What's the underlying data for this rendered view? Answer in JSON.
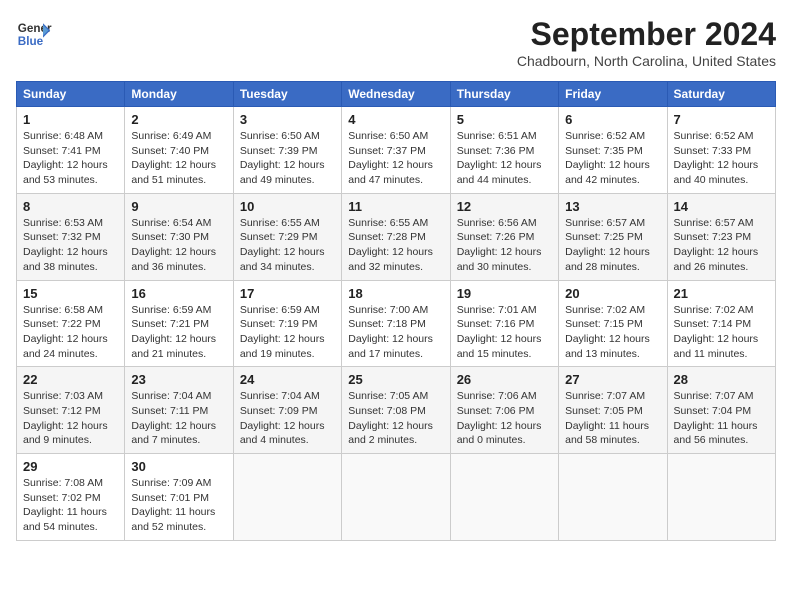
{
  "header": {
    "logo_line1": "General",
    "logo_line2": "Blue",
    "month": "September 2024",
    "location": "Chadbourn, North Carolina, United States"
  },
  "weekdays": [
    "Sunday",
    "Monday",
    "Tuesday",
    "Wednesday",
    "Thursday",
    "Friday",
    "Saturday"
  ],
  "weeks": [
    [
      {
        "day": "1",
        "info": "Sunrise: 6:48 AM\nSunset: 7:41 PM\nDaylight: 12 hours\nand 53 minutes."
      },
      {
        "day": "2",
        "info": "Sunrise: 6:49 AM\nSunset: 7:40 PM\nDaylight: 12 hours\nand 51 minutes."
      },
      {
        "day": "3",
        "info": "Sunrise: 6:50 AM\nSunset: 7:39 PM\nDaylight: 12 hours\nand 49 minutes."
      },
      {
        "day": "4",
        "info": "Sunrise: 6:50 AM\nSunset: 7:37 PM\nDaylight: 12 hours\nand 47 minutes."
      },
      {
        "day": "5",
        "info": "Sunrise: 6:51 AM\nSunset: 7:36 PM\nDaylight: 12 hours\nand 44 minutes."
      },
      {
        "day": "6",
        "info": "Sunrise: 6:52 AM\nSunset: 7:35 PM\nDaylight: 12 hours\nand 42 minutes."
      },
      {
        "day": "7",
        "info": "Sunrise: 6:52 AM\nSunset: 7:33 PM\nDaylight: 12 hours\nand 40 minutes."
      }
    ],
    [
      {
        "day": "8",
        "info": "Sunrise: 6:53 AM\nSunset: 7:32 PM\nDaylight: 12 hours\nand 38 minutes."
      },
      {
        "day": "9",
        "info": "Sunrise: 6:54 AM\nSunset: 7:30 PM\nDaylight: 12 hours\nand 36 minutes."
      },
      {
        "day": "10",
        "info": "Sunrise: 6:55 AM\nSunset: 7:29 PM\nDaylight: 12 hours\nand 34 minutes."
      },
      {
        "day": "11",
        "info": "Sunrise: 6:55 AM\nSunset: 7:28 PM\nDaylight: 12 hours\nand 32 minutes."
      },
      {
        "day": "12",
        "info": "Sunrise: 6:56 AM\nSunset: 7:26 PM\nDaylight: 12 hours\nand 30 minutes."
      },
      {
        "day": "13",
        "info": "Sunrise: 6:57 AM\nSunset: 7:25 PM\nDaylight: 12 hours\nand 28 minutes."
      },
      {
        "day": "14",
        "info": "Sunrise: 6:57 AM\nSunset: 7:23 PM\nDaylight: 12 hours\nand 26 minutes."
      }
    ],
    [
      {
        "day": "15",
        "info": "Sunrise: 6:58 AM\nSunset: 7:22 PM\nDaylight: 12 hours\nand 24 minutes."
      },
      {
        "day": "16",
        "info": "Sunrise: 6:59 AM\nSunset: 7:21 PM\nDaylight: 12 hours\nand 21 minutes."
      },
      {
        "day": "17",
        "info": "Sunrise: 6:59 AM\nSunset: 7:19 PM\nDaylight: 12 hours\nand 19 minutes."
      },
      {
        "day": "18",
        "info": "Sunrise: 7:00 AM\nSunset: 7:18 PM\nDaylight: 12 hours\nand 17 minutes."
      },
      {
        "day": "19",
        "info": "Sunrise: 7:01 AM\nSunset: 7:16 PM\nDaylight: 12 hours\nand 15 minutes."
      },
      {
        "day": "20",
        "info": "Sunrise: 7:02 AM\nSunset: 7:15 PM\nDaylight: 12 hours\nand 13 minutes."
      },
      {
        "day": "21",
        "info": "Sunrise: 7:02 AM\nSunset: 7:14 PM\nDaylight: 12 hours\nand 11 minutes."
      }
    ],
    [
      {
        "day": "22",
        "info": "Sunrise: 7:03 AM\nSunset: 7:12 PM\nDaylight: 12 hours\nand 9 minutes."
      },
      {
        "day": "23",
        "info": "Sunrise: 7:04 AM\nSunset: 7:11 PM\nDaylight: 12 hours\nand 7 minutes."
      },
      {
        "day": "24",
        "info": "Sunrise: 7:04 AM\nSunset: 7:09 PM\nDaylight: 12 hours\nand 4 minutes."
      },
      {
        "day": "25",
        "info": "Sunrise: 7:05 AM\nSunset: 7:08 PM\nDaylight: 12 hours\nand 2 minutes."
      },
      {
        "day": "26",
        "info": "Sunrise: 7:06 AM\nSunset: 7:06 PM\nDaylight: 12 hours\nand 0 minutes."
      },
      {
        "day": "27",
        "info": "Sunrise: 7:07 AM\nSunset: 7:05 PM\nDaylight: 11 hours\nand 58 minutes."
      },
      {
        "day": "28",
        "info": "Sunrise: 7:07 AM\nSunset: 7:04 PM\nDaylight: 11 hours\nand 56 minutes."
      }
    ],
    [
      {
        "day": "29",
        "info": "Sunrise: 7:08 AM\nSunset: 7:02 PM\nDaylight: 11 hours\nand 54 minutes."
      },
      {
        "day": "30",
        "info": "Sunrise: 7:09 AM\nSunset: 7:01 PM\nDaylight: 11 hours\nand 52 minutes."
      },
      {
        "day": "",
        "info": ""
      },
      {
        "day": "",
        "info": ""
      },
      {
        "day": "",
        "info": ""
      },
      {
        "day": "",
        "info": ""
      },
      {
        "day": "",
        "info": ""
      }
    ]
  ]
}
